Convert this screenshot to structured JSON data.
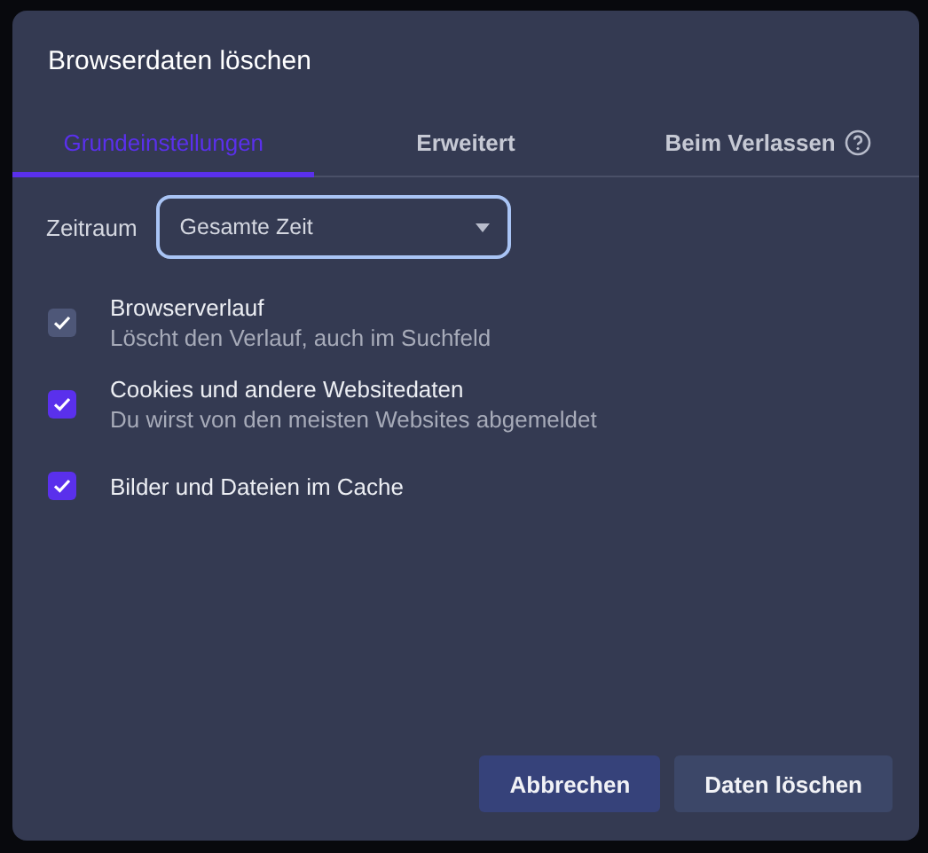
{
  "dialog": {
    "title": "Browserdaten löschen"
  },
  "tabs": [
    {
      "label": "Grundeinstellungen",
      "selected": true,
      "help": false
    },
    {
      "label": "Erweitert",
      "selected": false,
      "help": false
    },
    {
      "label": "Beim Verlassen",
      "selected": false,
      "help": true
    }
  ],
  "time_range": {
    "label": "Zeitraum",
    "value": "Gesamte Zeit"
  },
  "options": [
    {
      "label": "Browserverlauf",
      "description": "Löscht den Verlauf, auch im Suchfeld",
      "checked": true,
      "disabled": true
    },
    {
      "label": "Cookies und andere Websitedaten",
      "description": "Du wirst von den meisten Websites abgemeldet",
      "checked": true,
      "disabled": false
    },
    {
      "label": "Bilder und Dateien im Cache",
      "checked": true,
      "disabled": false
    }
  ],
  "buttons": [
    {
      "label": "Abbrechen",
      "kind": "secondary"
    },
    {
      "label": "Daten löschen",
      "kind": "primary"
    }
  ]
}
